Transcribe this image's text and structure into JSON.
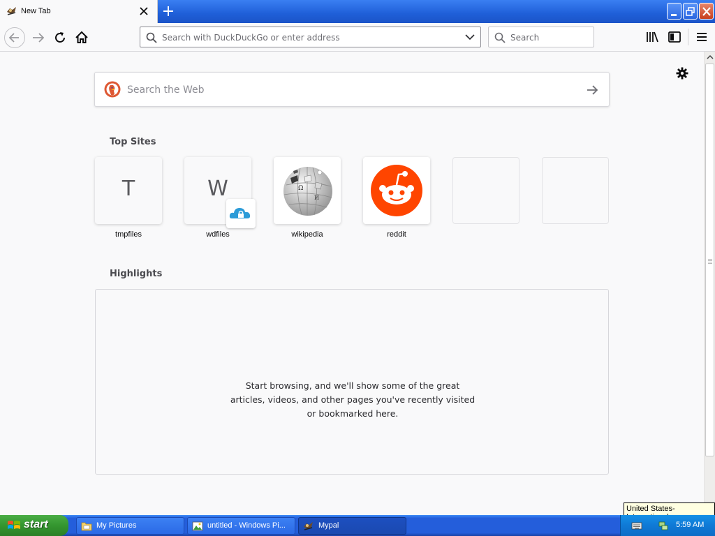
{
  "browser": {
    "tab": {
      "title": "New Tab"
    },
    "urlbar": {
      "placeholder": "Search with DuckDuckGo or enter address"
    },
    "searchbar": {
      "placeholder": "Search"
    }
  },
  "newtab": {
    "web_search": {
      "placeholder": "Search the Web"
    },
    "top_sites": {
      "title": "Top Sites",
      "tiles": [
        {
          "letter": "T",
          "label": "tmpfiles"
        },
        {
          "letter": "W",
          "label": "wdfiles"
        },
        {
          "letter": "",
          "label": "wikipedia"
        },
        {
          "letter": "",
          "label": "reddit"
        },
        {
          "letter": "",
          "label": ""
        },
        {
          "letter": "",
          "label": ""
        }
      ]
    },
    "highlights": {
      "title": "Highlights",
      "empty_message": "Start browsing, and we'll show some of the great articles, videos, and other pages you've recently visited or bookmarked here."
    }
  },
  "tooltip": {
    "text": "United States-International"
  },
  "taskbar": {
    "start_label": "start",
    "tasks": [
      {
        "label": "My Pictures"
      },
      {
        "label": "untitled - Windows Pi..."
      },
      {
        "label": "Mypal"
      }
    ],
    "clock": "5:59 AM"
  },
  "colors": {
    "reddit": "#ff4500",
    "taskbar": "#245edb",
    "start": "#34962f"
  }
}
